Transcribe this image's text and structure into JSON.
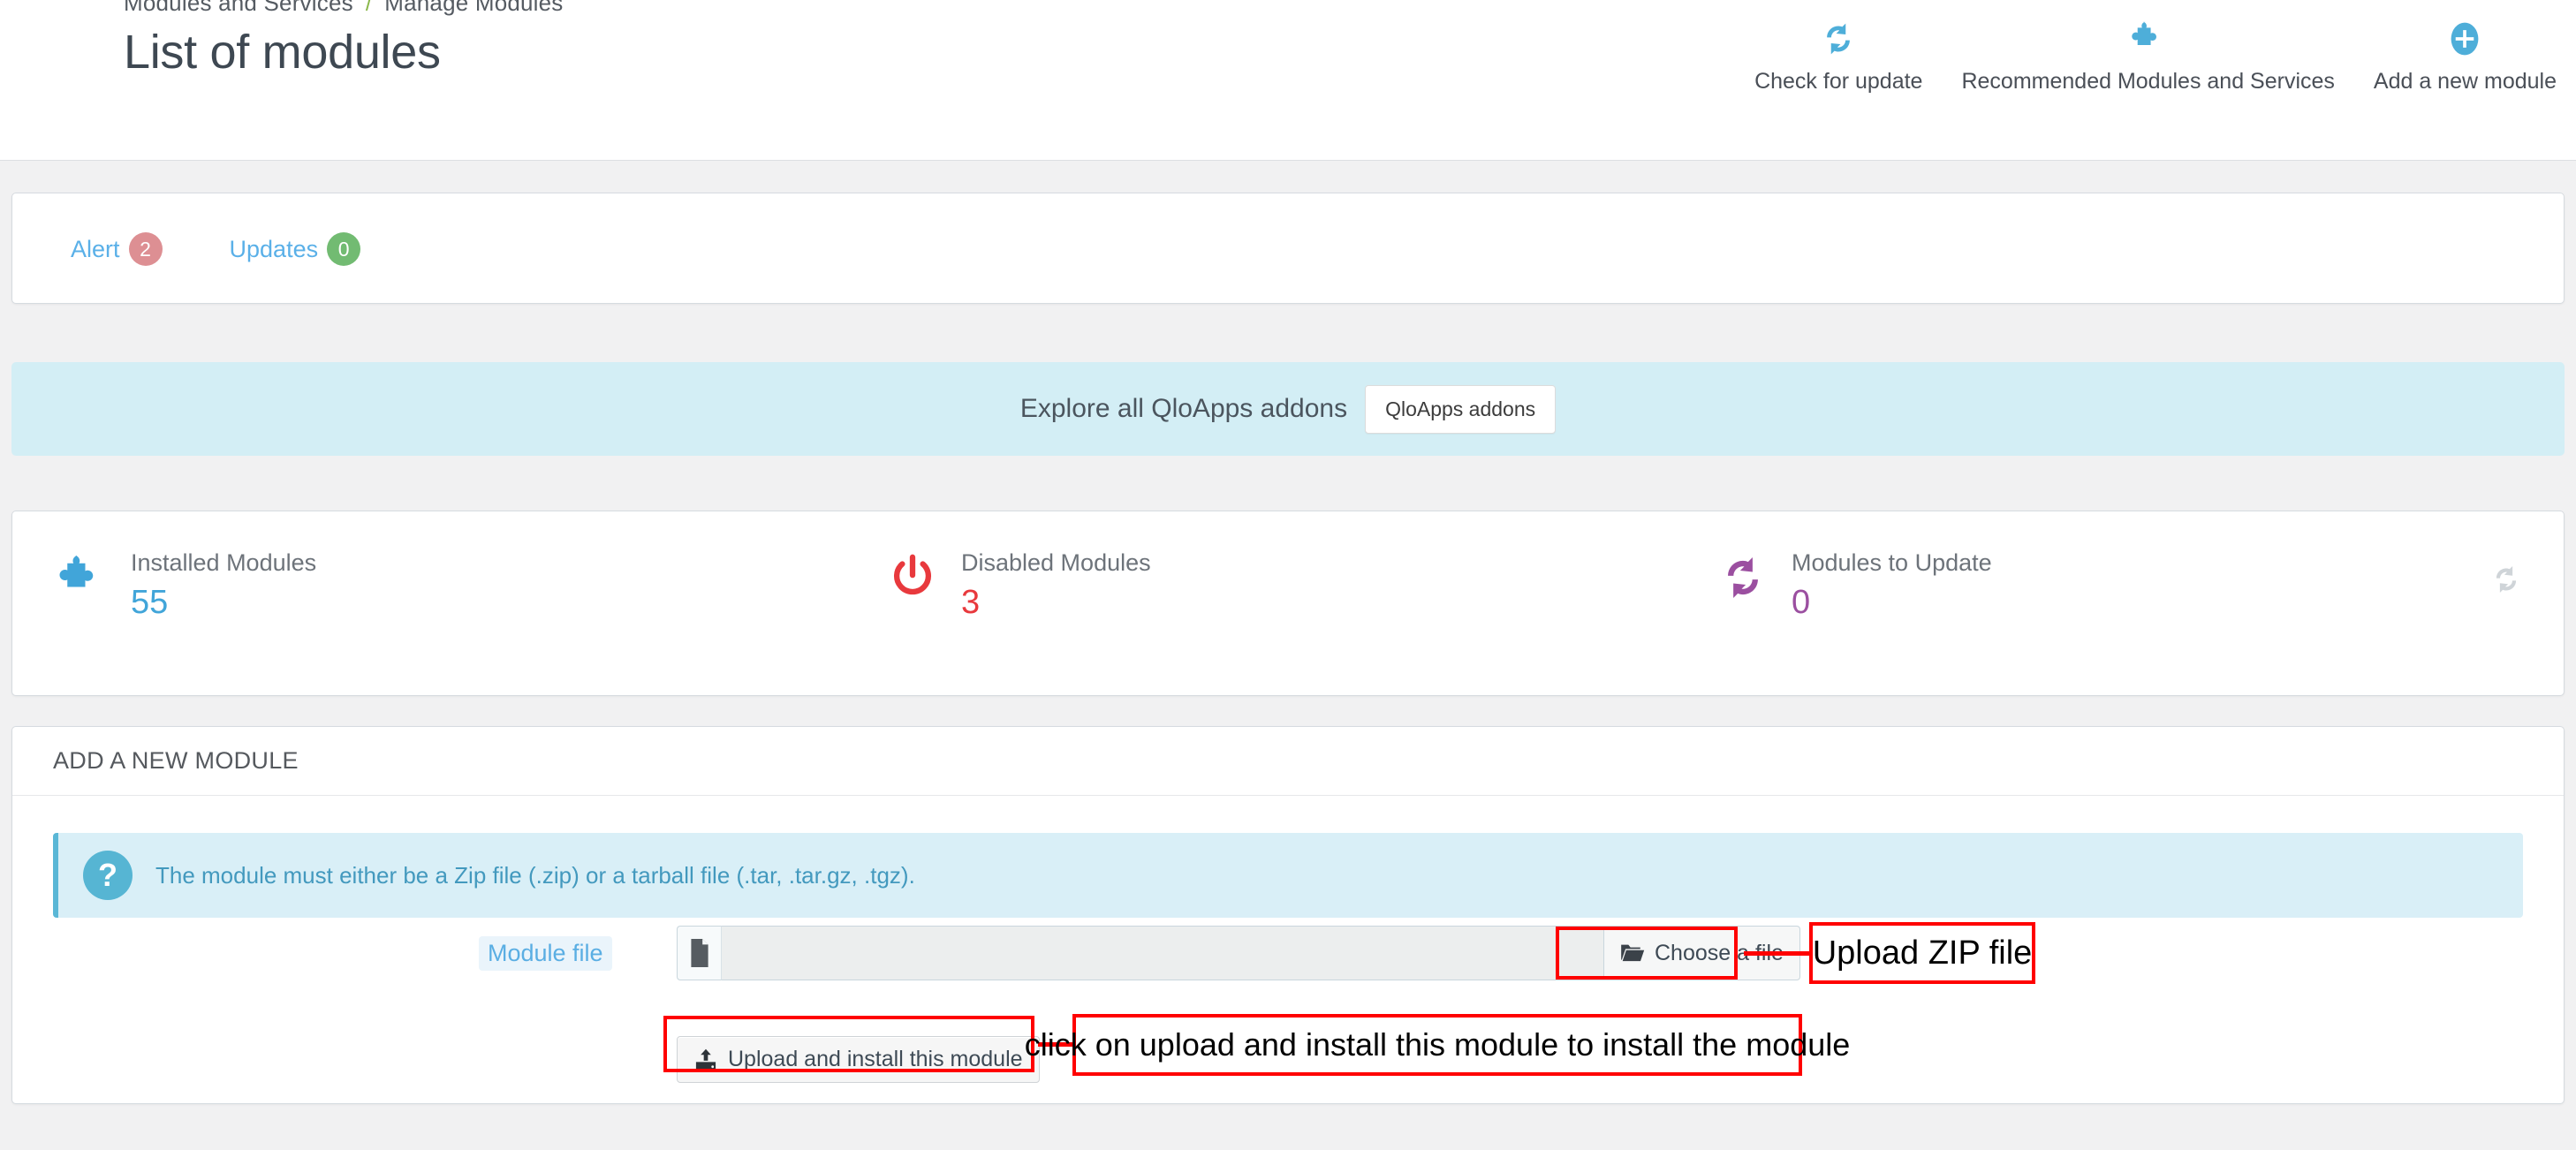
{
  "header": {
    "breadcrumb": [
      {
        "label": "Modules and Services"
      },
      {
        "label": "Manage Modules"
      }
    ],
    "breadcrumb_separator": "/",
    "title": "List of modules",
    "actions": [
      {
        "label": "Check for update",
        "icon": "refresh-icon"
      },
      {
        "label": "Recommended Modules and Services",
        "icon": "puzzle-icon"
      },
      {
        "label": "Add a new module",
        "icon": "plus-circle-icon"
      }
    ]
  },
  "filters": {
    "tabs": [
      {
        "label": "Alert",
        "count": "2",
        "style": "danger"
      },
      {
        "label": "Updates",
        "count": "0",
        "style": "success"
      }
    ]
  },
  "addons_banner": {
    "text": "Explore all QloApps addons",
    "button_label": "QloApps addons",
    "background": "#d3eef5"
  },
  "stats": [
    {
      "label": "Installed Modules",
      "value": "55",
      "icon": "puzzle-icon",
      "color": "#41a5d9"
    },
    {
      "label": "Disabled Modules",
      "value": "3",
      "icon": "power-icon",
      "color": "#e8393d"
    },
    {
      "label": "Modules to Update",
      "value": "0",
      "icon": "refresh-icon",
      "color": "#9b4fa0"
    }
  ],
  "stats_refresh_icon": "refresh-icon",
  "add_module": {
    "panel_title": "ADD A NEW MODULE",
    "info_icon": "question-mark-icon",
    "info_text": "The module must either be a Zip file (.zip) or a tarball file (.tar, .tar.gz, .tgz).",
    "file_label": "Module file",
    "file_icon": "file-icon",
    "file_value": "",
    "browse_icon": "folder-open-icon",
    "browse_label": "Choose a file",
    "submit_icon": "upload-icon",
    "submit_label": "Upload and install this module"
  },
  "annotations": {
    "accent_color": "#ff0000",
    "items": [
      {
        "text": "Upload ZIP file"
      },
      {
        "text": "click on upload and install this module to install the module"
      }
    ]
  }
}
